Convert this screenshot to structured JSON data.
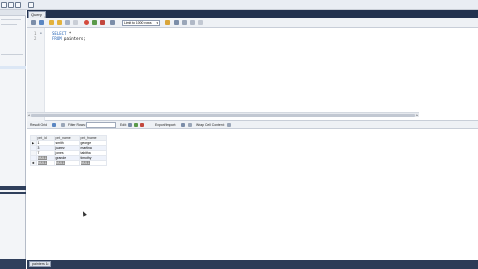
{
  "query_tab": {
    "label": "Query 1",
    "close": "×"
  },
  "editor": {
    "lines": [
      {
        "number": "1",
        "tokens": [
          {
            "text": "SELECT",
            "kw": true
          },
          {
            "text": " *",
            "kw": false
          }
        ]
      },
      {
        "number": "2",
        "tokens": [
          {
            "text": "FROM",
            "kw": true
          },
          {
            "text": " painters;",
            "kw": false
          }
        ]
      }
    ]
  },
  "toolbar": {
    "limit_label": "Limit to 1000 rows",
    "dropdown_arrow": "▾"
  },
  "result_toolbar": {
    "result_grid": "Result Grid",
    "filter_rows": "Filter Rows:",
    "edit": "Edit:",
    "export_import": "Export/Import:",
    "wrap_cell": "Wrap Cell Content:"
  },
  "grid": {
    "columns": [
      "pnt_id",
      "pnt_name",
      "pnt_fname"
    ],
    "rows": [
      [
        "1",
        "smith",
        "george"
      ],
      [
        "3",
        "juarez",
        "martina"
      ],
      [
        "7",
        "jones",
        "tabitha"
      ],
      [
        "NULL",
        "grande",
        "timothy"
      ],
      [
        "NULL",
        "NULL",
        "NULL"
      ]
    ],
    "row_markers": [
      "▶",
      "",
      "",
      "",
      "✱"
    ]
  },
  "bottom_tab": {
    "label": "painters 1",
    "close": "×"
  },
  "colors": {
    "tabbar": "#22324f",
    "navigator_dark": "#2f3f5c",
    "keyword": "#1e5fb3",
    "row_band": "#eef2fb"
  }
}
